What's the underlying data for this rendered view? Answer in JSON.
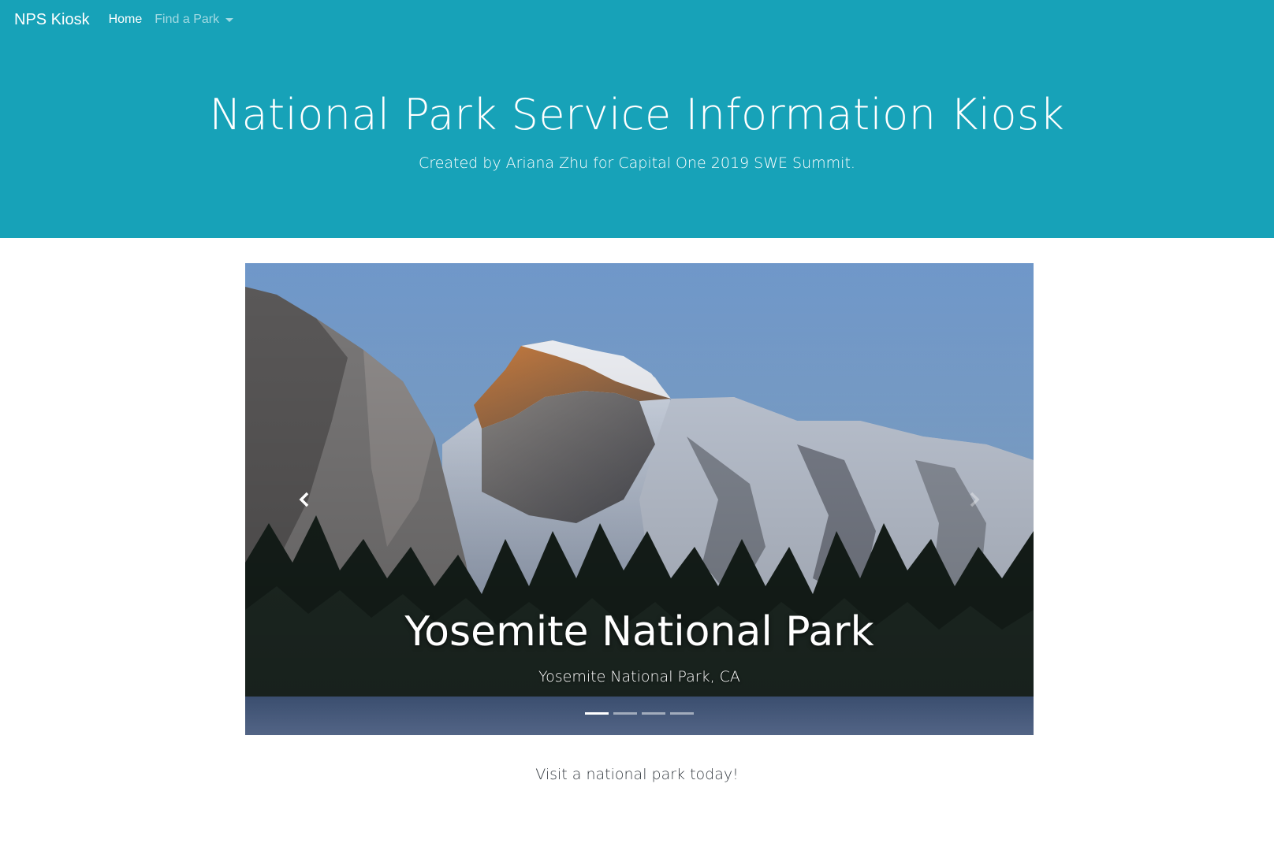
{
  "navbar": {
    "brand": "NPS Kiosk",
    "links": [
      {
        "label": "Home"
      },
      {
        "label": "Find a Park"
      }
    ]
  },
  "jumbotron": {
    "title": "National Park Service Information Kiosk",
    "subtitle": "Created by Ariana Zhu for Capital One 2019 SWE Summit."
  },
  "carousel": {
    "active_slide": {
      "title": "Yosemite National Park",
      "subtitle": "Yosemite National Park, CA"
    },
    "slide_count": 4,
    "active_index": 0
  },
  "tagline": "Visit a national park today!",
  "colors": {
    "primary": "#17a2b8",
    "text_dark": "#343a40",
    "white": "#ffffff"
  },
  "icons": [
    "chevron-left-icon",
    "chevron-right-icon",
    "caret-down-icon"
  ]
}
